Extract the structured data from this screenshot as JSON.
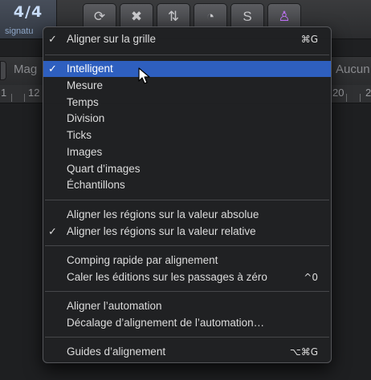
{
  "toolbar": {
    "signature_value": "4/4",
    "signature_label": "signatu",
    "buttons": [
      {
        "icon": "cycle-icon",
        "glyph": "⟳"
      },
      {
        "icon": "delete-box-icon",
        "glyph": "✖"
      },
      {
        "icon": "bounce-arrows-icon",
        "glyph": "⇅"
      },
      {
        "icon": "gauge-icon",
        "glyph": "◔"
      },
      {
        "icon": "solo-icon",
        "glyph": "S"
      },
      {
        "icon": "metronome-icon",
        "glyph": "♙"
      }
    ]
  },
  "controlbar": {
    "left_label": "Mag",
    "right_label": "Aucun"
  },
  "ruler": {
    "numbers": [
      "1",
      "12",
      "20",
      "2"
    ]
  },
  "menu": {
    "items": [
      {
        "key": "snap-to-grid",
        "label": "Aligner sur la grille",
        "checked": true,
        "shortcut": "⌘G"
      },
      {
        "key": "smart",
        "label": "Intelligent",
        "checked": true,
        "selected": true
      },
      {
        "key": "bar",
        "label": "Mesure"
      },
      {
        "key": "beat",
        "label": "Temps"
      },
      {
        "key": "division",
        "label": "Division"
      },
      {
        "key": "ticks",
        "label": "Ticks"
      },
      {
        "key": "frames",
        "label": "Images"
      },
      {
        "key": "quarter-frames",
        "label": "Quart d’images"
      },
      {
        "key": "samples",
        "label": "Échantillons"
      },
      {
        "key": "snap-absolute",
        "label": "Aligner les régions sur la valeur absolue"
      },
      {
        "key": "snap-relative",
        "label": "Aligner les régions sur la valeur relative",
        "checked": true
      },
      {
        "key": "quick-swipe-comping",
        "label": "Comping rapide par alignement"
      },
      {
        "key": "snap-zero-crossings",
        "label": "Caler les éditions sur les passages à zéro",
        "shortcut": "^0"
      },
      {
        "key": "snap-automation",
        "label": "Aligner l’automation"
      },
      {
        "key": "automation-snap-offset",
        "label": "Décalage d’alignement de l’automation…"
      },
      {
        "key": "alignment-guides",
        "label": "Guides d’alignement",
        "shortcut": "⌥⌘G"
      }
    ],
    "check_glyph": "✓"
  }
}
